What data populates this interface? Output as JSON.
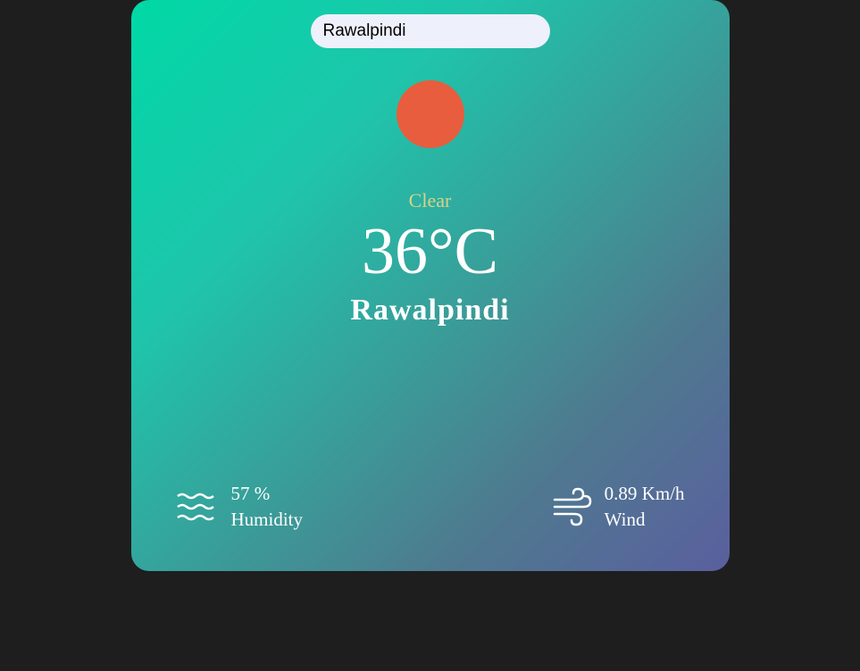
{
  "search": {
    "value": "Rawalpindi"
  },
  "weather": {
    "condition": "Clear",
    "temperature": "36°C",
    "city": "Rawalpindi"
  },
  "stats": {
    "humidity": {
      "value": "57 %",
      "label": "Humidity"
    },
    "wind": {
      "value": "0.89 Km/h",
      "label": "Wind"
    }
  }
}
